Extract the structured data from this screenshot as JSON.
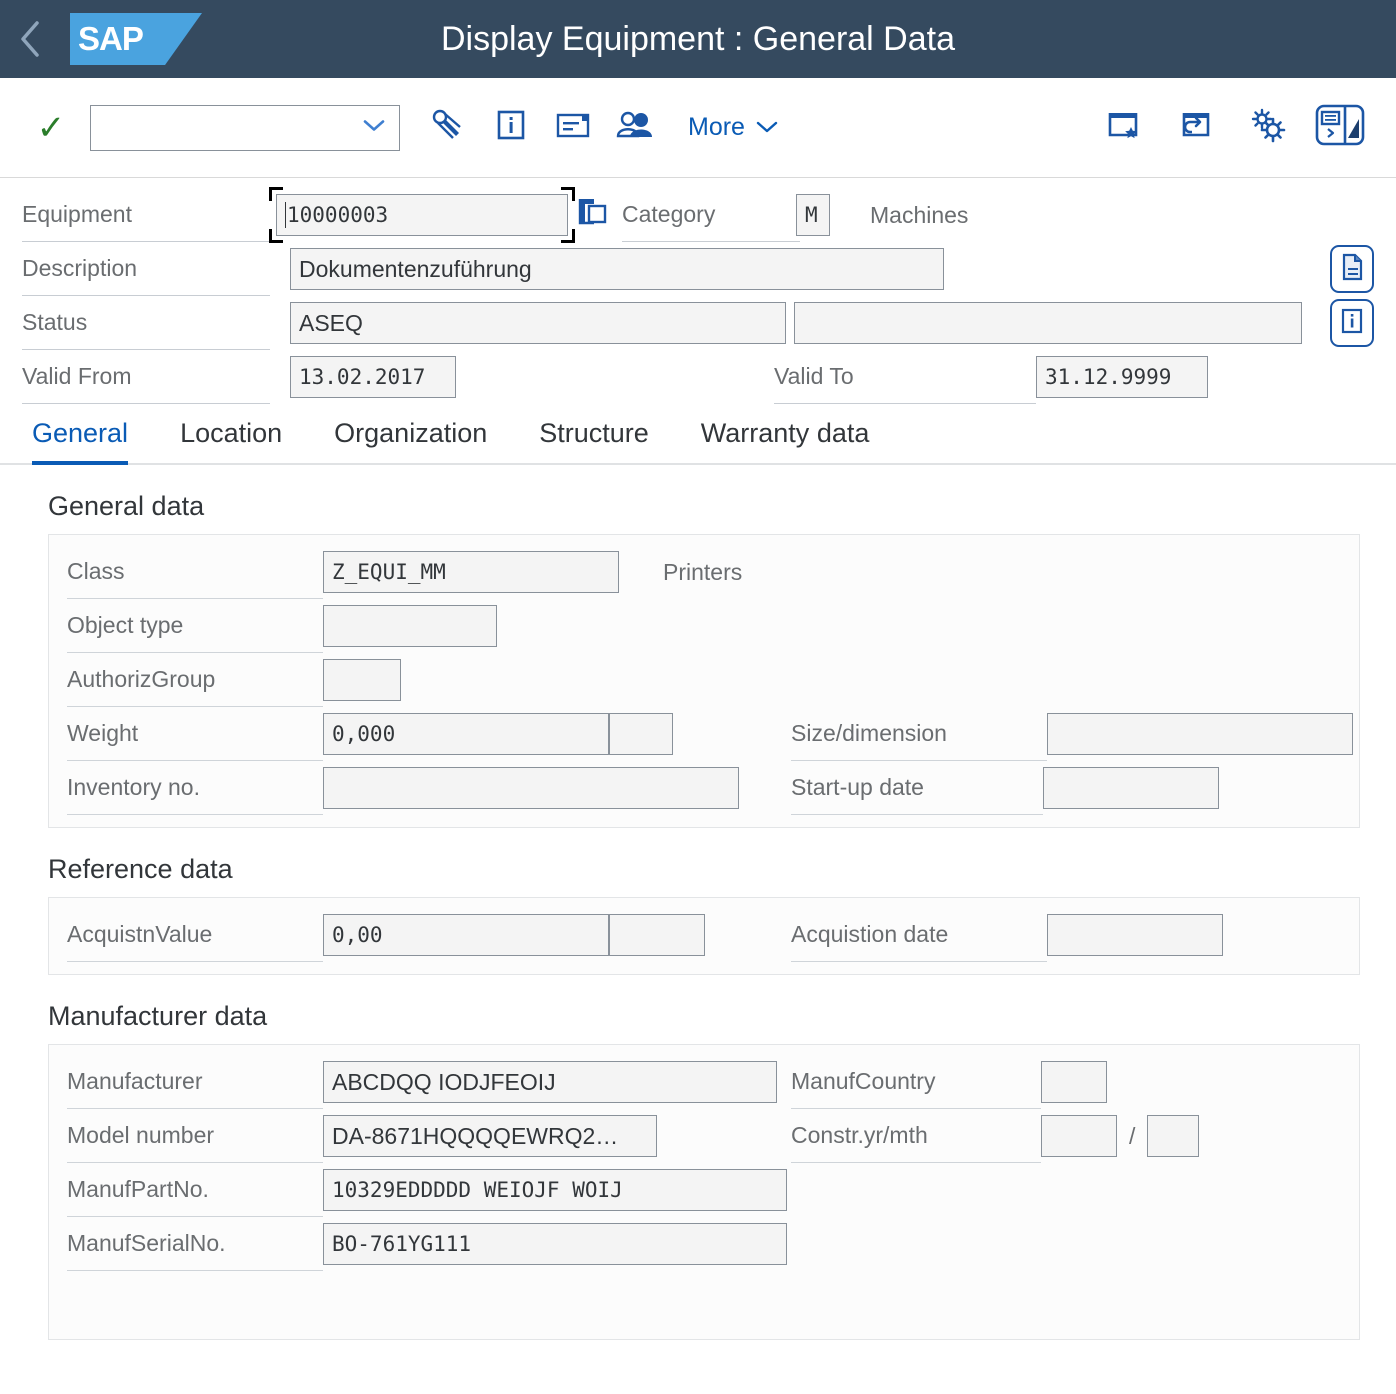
{
  "shell": {
    "title": "Display Equipment : General Data",
    "logo_text": "SAP",
    "back_icon": "back-chevron-icon"
  },
  "toolbar": {
    "confirm_icon": "check-icon",
    "command_field_value": "",
    "command_field_placeholder": "",
    "dropdown_icon": "chevron-down-icon",
    "icons": [
      {
        "name": "measuring-points-icon",
        "label": ""
      },
      {
        "name": "info-box-icon",
        "label": ""
      },
      {
        "name": "long-text-icon",
        "label": ""
      },
      {
        "name": "partners-icon",
        "label": ""
      }
    ],
    "more_label": "More",
    "right_icons": [
      {
        "name": "add-to-favorites-icon"
      },
      {
        "name": "open-in-new-window-icon"
      },
      {
        "name": "settings-gears-icon"
      },
      {
        "name": "feedback-and-resize-icon"
      }
    ]
  },
  "header_fields": {
    "equipment_label": "Equipment",
    "equipment_value": "10000003",
    "equipment_value_help_icon": "value-help-icon",
    "category_label": "Category",
    "category_value": "M",
    "category_text": "Machines",
    "description_label": "Description",
    "description_value": "Dokumentenzuführung",
    "status_label": "Status",
    "status_value": "ASEQ",
    "status_value2": "",
    "valid_from_label": "Valid From",
    "valid_from_value": "13.02.2017",
    "valid_to_label": "Valid To",
    "valid_to_value": "31.12.9999",
    "side_buttons": [
      {
        "name": "long-text-document-icon"
      },
      {
        "name": "status-info-icon"
      }
    ]
  },
  "tabs": [
    {
      "label": "General",
      "active": true
    },
    {
      "label": "Location",
      "active": false
    },
    {
      "label": "Organization",
      "active": false
    },
    {
      "label": "Structure",
      "active": false
    },
    {
      "label": "Warranty data",
      "active": false
    }
  ],
  "sections": {
    "general": {
      "title": "General data",
      "class_label": "Class",
      "class_value": "Z_EQUI_MM",
      "class_text": "Printers",
      "object_type_label": "Object type",
      "object_type_value": "",
      "authoriz_group_label": "AuthorizGroup",
      "authoriz_group_value": "",
      "weight_label": "Weight",
      "weight_value": "0,000",
      "weight_unit": "",
      "size_dimension_label": "Size/dimension",
      "size_dimension_value": "",
      "inventory_no_label": "Inventory no.",
      "inventory_no_value": "",
      "start_up_date_label": "Start-up date",
      "start_up_date_value": ""
    },
    "reference": {
      "title": "Reference data",
      "acquistn_value_label": "AcquistnValue",
      "acquistn_value_value": "0,00",
      "acquistn_currency": "",
      "acquistion_date_label": "Acquistion date",
      "acquistion_date_value": ""
    },
    "manufacturer": {
      "title": "Manufacturer data",
      "manufacturer_label": "Manufacturer",
      "manufacturer_value": "ABCDQQ IODJFEOIJ",
      "manuf_country_label": "ManufCountry",
      "manuf_country_value": "",
      "model_number_label": "Model number",
      "model_number_value": "DA-8671HQQQQEWRQ2…",
      "constr_yr_mth_label": "Constr.yr/mth",
      "constr_yr_value": "",
      "constr_mth_value": "",
      "constr_separator": "/",
      "manuf_part_no_label": "ManufPartNo.",
      "manuf_part_no_value": "10329EDDDDD WEIOJF WOIJ",
      "manuf_serial_no_label": "ManufSerialNo.",
      "manuf_serial_no_value": "BO-761YG111"
    }
  },
  "colors": {
    "shell_header_bg": "#354a5f",
    "logo_blue": "#4aa3df",
    "accent_blue": "#0a5bb5",
    "field_bg": "#f4f4f4",
    "field_border": "#89919a",
    "label_gray": "#6a6d70",
    "confirm_green": "#2b7d2b"
  }
}
